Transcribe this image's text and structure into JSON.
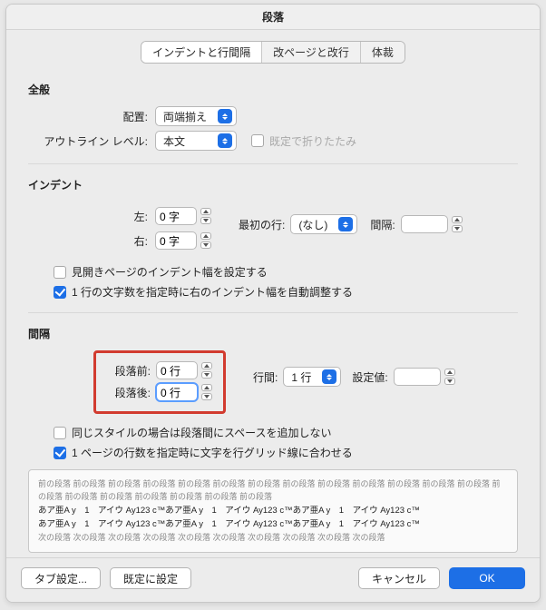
{
  "window": {
    "title": "段落"
  },
  "tabs": {
    "t0": "インデントと行間隔",
    "t1": "改ページと改行",
    "t2": "体裁",
    "selected": 0
  },
  "general": {
    "heading": "全般",
    "alignment_label": "配置:",
    "alignment_value": "両端揃え",
    "outline_label": "アウトライン レベル:",
    "outline_value": "本文",
    "collapsed_label": "既定で折りたたみ",
    "collapsed_checked": false,
    "collapsed_disabled": true
  },
  "indent": {
    "heading": "インデント",
    "left_label": "左:",
    "left_value": "0 字",
    "right_label": "右:",
    "right_value": "0 字",
    "firstline_label": "最初の行:",
    "firstline_value": "(なし)",
    "firstline_amount_label": "間隔:",
    "firstline_amount_value": "",
    "mirror_label": "見開きページのインデント幅を設定する",
    "mirror_checked": false,
    "autoadjust_label": "1 行の文字数を指定時に右のインデント幅を自動調整する",
    "autoadjust_checked": true
  },
  "spacing": {
    "heading": "間隔",
    "before_label": "段落前:",
    "before_value": "0 行",
    "after_label": "段落後:",
    "after_value": "0 行",
    "line_label": "行間:",
    "line_value": "1 行",
    "line_at_label": "設定値:",
    "line_at_value": "",
    "nos_label": "同じスタイルの場合は段落間にスペースを追加しない",
    "nos_checked": false,
    "snap_label": "1 ページの行数を指定時に文字を行グリッド線に合わせる",
    "snap_checked": true
  },
  "preview": {
    "before": "前の段落 前の段落 前の段落 前の段落 前の段落 前の段落 前の段落 前の段落 前の段落 前の段落 前の段落 前の段落 前の段落 前の段落 前の段落 前の段落 前の段落 前の段落 前の段落 前の段落",
    "body1": "あア亜A y　1　アイウ Ay123 c™あア亜A y　1　アイウ Ay123 c™あア亜A y　1　アイウ Ay123 c™",
    "body2": "あア亜A y　1　アイウ Ay123 c™あア亜A y　1　アイウ Ay123 c™あア亜A y　1　アイウ Ay123 c™",
    "after": "次の段落 次の段落 次の段落 次の段落 次の段落 次の段落 次の段落 次の段落 次の段落 次の段落"
  },
  "footer": {
    "tabs_btn": "タブ設定...",
    "default_btn": "既定に設定",
    "cancel": "キャンセル",
    "ok": "OK"
  }
}
